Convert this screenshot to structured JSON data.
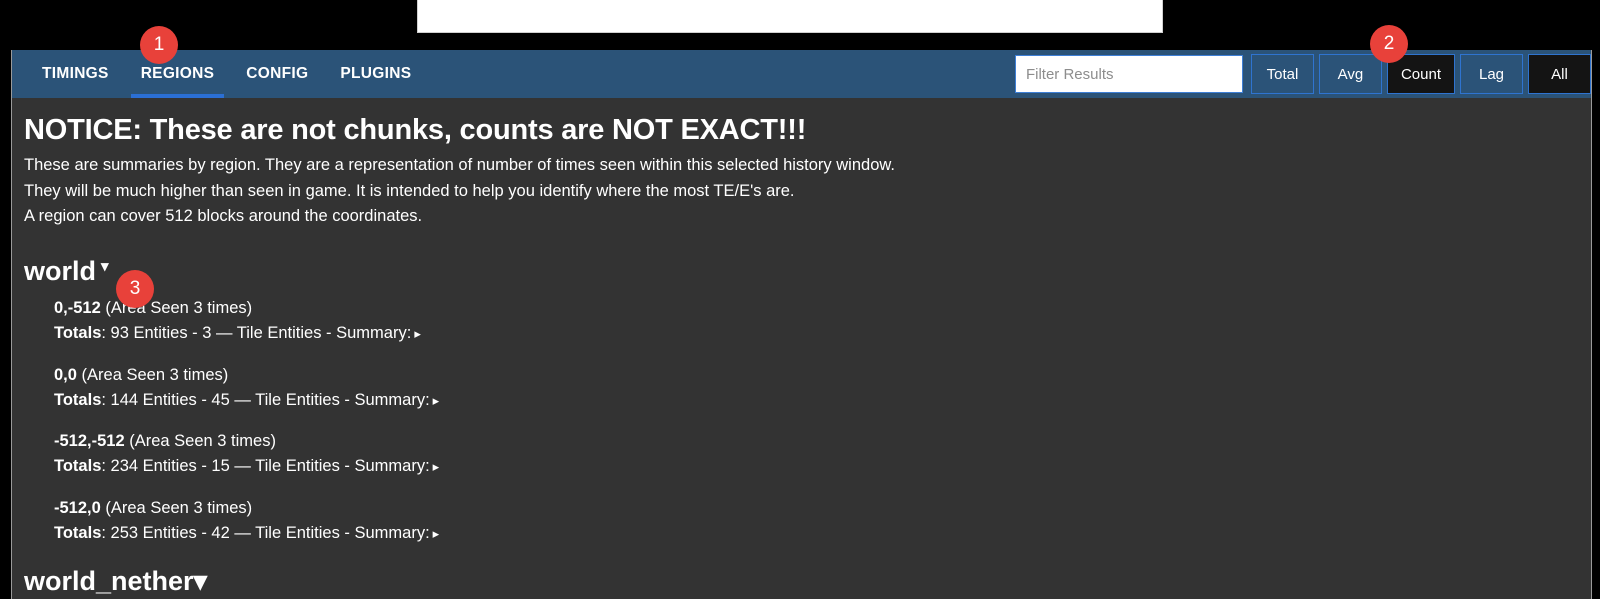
{
  "window": {
    "background_color": "#000000",
    "panel_color": "#333333",
    "nav_color": "#2b5378",
    "accent_color": "#2f74d0",
    "badge_color": "#e8413a"
  },
  "nav": {
    "tabs": [
      {
        "label": "TIMINGS",
        "active": false
      },
      {
        "label": "REGIONS",
        "active": true
      },
      {
        "label": "CONFIG",
        "active": false
      },
      {
        "label": "PLUGINS",
        "active": false
      }
    ],
    "filter": {
      "placeholder": "Filter Results",
      "value": ""
    },
    "metric_buttons": [
      {
        "label": "Total",
        "active": false
      },
      {
        "label": "Avg",
        "active": false
      },
      {
        "label": "Count",
        "active": true
      },
      {
        "label": "Lag",
        "active": false
      },
      {
        "label": "All",
        "active": true
      }
    ]
  },
  "annotations": [
    {
      "number": "1",
      "target": "regions-tab"
    },
    {
      "number": "2",
      "target": "count-button"
    },
    {
      "number": "3",
      "target": "world-heading"
    }
  ],
  "notice": {
    "title": "NOTICE: These are not chunks, counts are NOT EXACT!!!",
    "lines": [
      "These are summaries by region. They are a representation of number of times seen within this selected history window.",
      "They will be much higher than seen in game. It is intended to help you identify where the most TE/E's are.",
      "A region can cover 512 blocks around the coordinates."
    ]
  },
  "worlds": [
    {
      "name": "world",
      "caret": "▾",
      "regions": [
        {
          "coords": "0,-512",
          "seen_text": "(Area Seen 3 times)",
          "totals_label": "Totals",
          "totals_text": ": 93 Entities - 3 — Tile Entities - Summary:",
          "summary_caret": "▸"
        },
        {
          "coords": "0,0",
          "seen_text": "(Area Seen 3 times)",
          "totals_label": "Totals",
          "totals_text": ": 144 Entities - 45 — Tile Entities - Summary:",
          "summary_caret": "▸"
        },
        {
          "coords": "-512,-512",
          "seen_text": "(Area Seen 3 times)",
          "totals_label": "Totals",
          "totals_text": ": 234 Entities - 15 — Tile Entities - Summary:",
          "summary_caret": "▸"
        },
        {
          "coords": "-512,0",
          "seen_text": "(Area Seen 3 times)",
          "totals_label": "Totals",
          "totals_text": ": 253 Entities - 42 — Tile Entities - Summary:",
          "summary_caret": "▸"
        }
      ]
    },
    {
      "name": "world_nether",
      "caret": "▾",
      "regions": []
    }
  ]
}
